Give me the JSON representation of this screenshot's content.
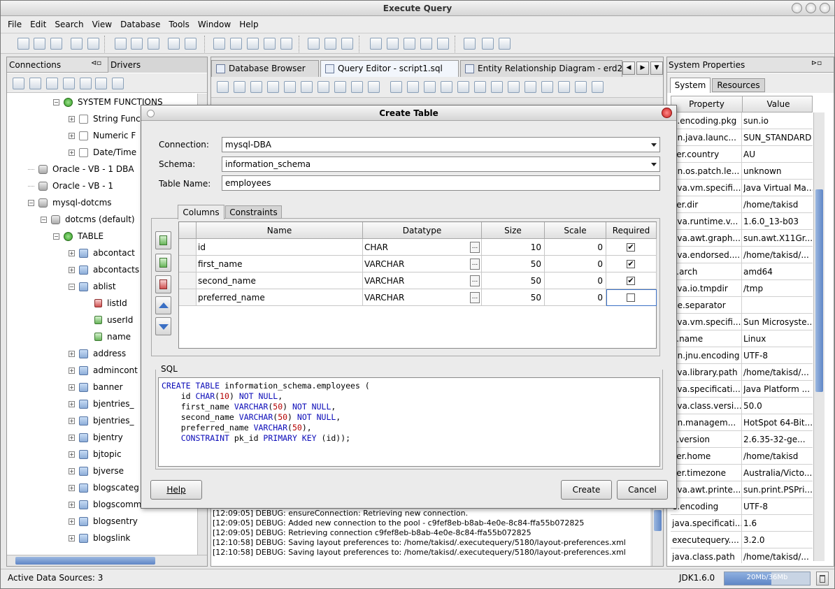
{
  "window": {
    "title": "Execute Query"
  },
  "menu": [
    "File",
    "Edit",
    "Search",
    "View",
    "Database",
    "Tools",
    "Window",
    "Help"
  ],
  "left_panel": {
    "tabs": [
      "Connections",
      "Drivers"
    ],
    "tree": [
      {
        "label": "SYSTEM FUNCTIONS",
        "icon": "green-dot-icon"
      },
      {
        "label": "String Func",
        "icon": "function-icon"
      },
      {
        "label": "Numeric F",
        "icon": "function-icon"
      },
      {
        "label": "Date/Time",
        "icon": "function-icon"
      },
      {
        "label": "Oracle - VB - 1 DBA",
        "icon": "database-icon"
      },
      {
        "label": "Oracle - VB - 1",
        "icon": "database-icon"
      },
      {
        "label": "mysql-dotcms",
        "icon": "database-connected-icon"
      },
      {
        "label": "dotcms (default)",
        "icon": "database-icon"
      },
      {
        "label": "TABLE",
        "icon": "green-dot-icon"
      },
      {
        "label": "abcontact",
        "icon": "table-icon"
      },
      {
        "label": "abcontacts",
        "icon": "table-icon"
      },
      {
        "label": "ablist",
        "icon": "table-icon"
      },
      {
        "label": "listId",
        "icon": "key-column-icon"
      },
      {
        "label": "userId",
        "icon": "column-icon"
      },
      {
        "label": "name",
        "icon": "column-icon"
      },
      {
        "label": "address",
        "icon": "table-icon"
      },
      {
        "label": "admincont",
        "icon": "table-icon"
      },
      {
        "label": "banner",
        "icon": "table-icon"
      },
      {
        "label": "bjentries_",
        "icon": "table-icon"
      },
      {
        "label": "bjentries_",
        "icon": "table-icon"
      },
      {
        "label": "bjentry",
        "icon": "table-icon"
      },
      {
        "label": "bjtopic",
        "icon": "table-icon"
      },
      {
        "label": "bjverse",
        "icon": "table-icon"
      },
      {
        "label": "blogscateg",
        "icon": "table-icon"
      },
      {
        "label": "blogscomm",
        "icon": "table-icon"
      },
      {
        "label": "blogsentry",
        "icon": "table-icon"
      },
      {
        "label": "blogslink",
        "icon": "table-icon"
      }
    ]
  },
  "editor_tabs": [
    "Database Browser",
    "Query Editor - script1.sql",
    "Entity Relationship Diagram - erd2."
  ],
  "right_panel": {
    "title": "System Properties",
    "tabs": [
      "System",
      "Resources"
    ],
    "headers": [
      "Property",
      "Value"
    ],
    "rows": [
      [
        "e.encoding.pkg",
        "sun.io"
      ],
      [
        "un.java.launc...",
        "SUN_STANDARD"
      ],
      [
        "ser.country",
        "AU"
      ],
      [
        "un.os.patch.le...",
        "unknown"
      ],
      [
        "ava.vm.specifi...",
        "Java Virtual Ma..."
      ],
      [
        "ser.dir",
        "/home/takisd"
      ],
      [
        "ava.runtime.v...",
        "1.6.0_13-b03"
      ],
      [
        "ava.awt.graph...",
        "sun.awt.X11Gr..."
      ],
      [
        "ava.endorsed....",
        "/home/takisd/..."
      ],
      [
        "s.arch",
        "amd64"
      ],
      [
        "ava.io.tmpdir",
        "/tmp"
      ],
      [
        "ne.separator",
        ""
      ],
      [
        "ava.vm.specifi...",
        "Sun Microsyste..."
      ],
      [
        "s.name",
        "Linux"
      ],
      [
        "un.jnu.encoding",
        "UTF-8"
      ],
      [
        "ava.library.path",
        "/home/takisd/..."
      ],
      [
        "ava.specificati...",
        "Java Platform ..."
      ],
      [
        "ava.class.versi...",
        "50.0"
      ],
      [
        "un.managem...",
        "HotSpot 64-Bit..."
      ],
      [
        "s.version",
        "2.6.35-32-ge..."
      ],
      [
        "ser.home",
        "/home/takisd"
      ],
      [
        "ser.timezone",
        "Australia/Victo..."
      ],
      [
        "ava.awt.printe...",
        "sun.print.PSPri..."
      ],
      [
        "e.encoding",
        "UTF-8"
      ],
      [
        "java.specificati...",
        "1.6"
      ],
      [
        "executequery....",
        "3.2.0"
      ],
      [
        "java.class.path",
        "/home/takisd/..."
      ]
    ]
  },
  "log": [
    "[12:09:05] DEBUG: ensureConnection: Retrieving new connection.",
    "[12:09:05] DEBUG: Added new connection to the pool - c9fef8eb-b8ab-4e0e-8c84-ffa55b072825",
    "[12:09:05] DEBUG: Retrieving connection c9fef8eb-b8ab-4e0e-8c84-ffa55b072825",
    "[12:10:58] DEBUG: Saving layout preferences to: /home/takisd/.executequery/5180/layout-preferences.xml",
    "[12:10:58] DEBUG: Saving layout preferences to: /home/takisd/.executequery/5180/layout-preferences.xml"
  ],
  "status": {
    "left": "Active Data Sources: 3",
    "jdk": "JDK1.6.0",
    "memory": "20Mb/36Mb",
    "memory_fraction": 0.55
  },
  "dialog": {
    "title": "Create Table",
    "connection_label": "Connection:",
    "connection_value": "mysql-DBA",
    "schema_label": "Schema:",
    "schema_value": "information_schema",
    "tablename_label": "Table Name:",
    "tablename_value": "employees",
    "tabs": [
      "Columns",
      "Constraints"
    ],
    "col_headers": [
      "Name",
      "Datatype",
      "Size",
      "Scale",
      "Required"
    ],
    "columns": [
      {
        "name": "id",
        "type": "CHAR",
        "size": "10",
        "scale": "0",
        "required": true
      },
      {
        "name": "first_name",
        "type": "VARCHAR",
        "size": "50",
        "scale": "0",
        "required": true
      },
      {
        "name": "second_name",
        "type": "VARCHAR",
        "size": "50",
        "scale": "0",
        "required": true
      },
      {
        "name": "preferred_name",
        "type": "VARCHAR",
        "size": "50",
        "scale": "0",
        "required": false
      }
    ],
    "sql_label": "SQL",
    "buttons": {
      "help": "Help",
      "create": "Create",
      "cancel": "Cancel"
    }
  }
}
